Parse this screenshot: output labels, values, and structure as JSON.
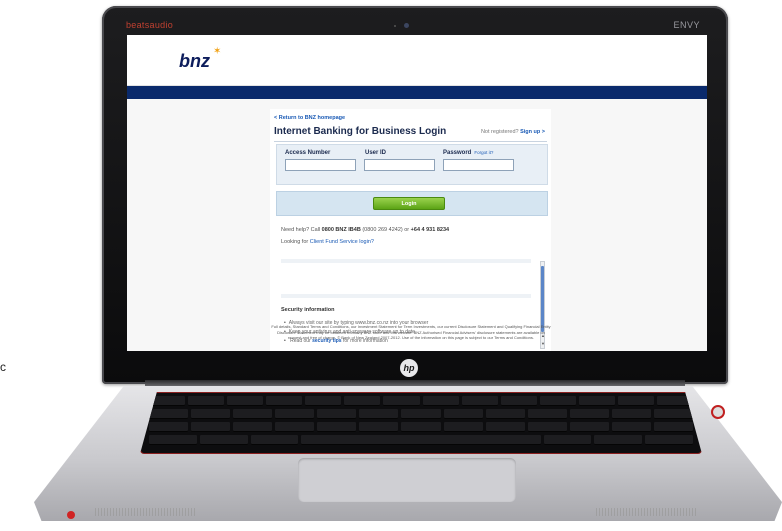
{
  "laptop": {
    "brand_text": "beatsaudio",
    "model_text": "ENVY",
    "hp_logo_text": "hp"
  },
  "site": {
    "logo_text": "bnz"
  },
  "login": {
    "back_link": "< Return to BNZ homepage",
    "title": "Internet Banking for Business Login",
    "not_registered": "Not registered?",
    "sign_up": "Sign up >",
    "fields": {
      "access_number_label": "Access Number",
      "user_id_label": "User ID",
      "password_label": "Password",
      "forgot_link": "Forgot it?",
      "access_number_value": "",
      "user_id_value": "",
      "password_value": ""
    },
    "login_button": "Login"
  },
  "help": {
    "need_help_prefix": "Need help? Call",
    "phone_main": "0800 BNZ IB4B",
    "phone_alt": "(0800 269 4242) or",
    "phone_intl": "+64 4 931 8234",
    "looking_for": "Looking for",
    "client_fund_link": "Client Fund Service login?"
  },
  "security": {
    "title": "Security information",
    "items": [
      "Always visit our site by typing www.bnz.co.nz into your browser",
      "Keep your antivirus and anti-spyware software up to date"
    ],
    "read_prefix": "Read our",
    "security_tips_link": "security tips",
    "read_suffix": "for more information"
  },
  "footer": {
    "text": "Full details, Standard Terms and Conditions, our Investment Statement for Term Investments, our current Disclosure Statement and Qualifying Financial Entity Disclosure Statement may be obtained from any BNZ store and this website. BNZ Authorised Financial Advisers' disclosure statements are available on request and free of charge. © Bank of New Zealand 2007-2012. Use of the information on this page is subject to our Terms and Conditions."
  },
  "stray_text": "c",
  "colors": {
    "bnz_navy": "#0a2a6c",
    "link_blue": "#1a5ab5",
    "login_green": "#5ca416",
    "form_bg": "#e8eff6"
  }
}
